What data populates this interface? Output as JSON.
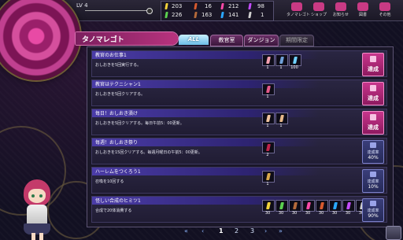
{
  "header": {
    "level_label": "LV 4",
    "resources": [
      {
        "value": "203",
        "color": "#f2d23a"
      },
      {
        "value": "16",
        "color": "#d85a2e"
      },
      {
        "value": "212",
        "color": "#ff4aa8"
      },
      {
        "value": "98",
        "color": "#c44cff"
      },
      {
        "value": "226",
        "color": "#5bd14f"
      },
      {
        "value": "163",
        "color": "#b46a3a"
      },
      {
        "value": "141",
        "color": "#2aa8ff"
      },
      {
        "value": "1",
        "color": "#cfcfcf"
      }
    ],
    "nav": [
      {
        "label": "タノマレゴト",
        "icon": "scroll-icon",
        "color": "#c93a84"
      },
      {
        "label": "ショップ",
        "icon": "shop-icon",
        "color": "#c93a84"
      },
      {
        "label": "お知らせ",
        "icon": "mail-icon",
        "color": "#c93a84"
      },
      {
        "label": "図書",
        "icon": "book-icon",
        "color": "#c93a84"
      },
      {
        "label": "その他",
        "icon": "menu-icon",
        "color": "#c93a84"
      }
    ]
  },
  "page": {
    "title": "タノマレゴト",
    "tabs": [
      "ALL",
      "教官室",
      "ダンジョン",
      "期間限定"
    ]
  },
  "quests": [
    {
      "title": "教官のお仕事1",
      "desc": "おしおきを5回実行する。",
      "status": "達成",
      "rewards": [
        {
          "color": "#f3a0b0",
          "qty": "1"
        },
        {
          "color": "#6fa0d8",
          "qty": "1"
        },
        {
          "color": "#6fd0ff",
          "qty": "100"
        }
      ]
    },
    {
      "title": "教官はテクニシャン1",
      "desc": "おしおきを5回クリアする。",
      "status": "達成",
      "rewards": [
        {
          "color": "#e45a8a",
          "qty": "1"
        }
      ]
    },
    {
      "title": "毎日！おしおき漬け",
      "desc": "おしおきを5回クリアする。毎日午前5：00更新。",
      "status": "達成",
      "rewards": [
        {
          "color": "#f1c4a0",
          "qty": "1"
        },
        {
          "color": "#e8b88a",
          "qty": "1"
        }
      ]
    },
    {
      "title": "毎週！おしおき祭り",
      "desc": "おしおきを15回クリアする。毎週月曜日の午前5：00更新。",
      "status": "達成率",
      "percent": "40%",
      "rewards": [
        {
          "color": "#c0244a",
          "qty": "2"
        }
      ]
    },
    {
      "title": "ハーレムをつくろう1",
      "desc": "召喚を10回する",
      "status": "達成率",
      "percent": "10%",
      "rewards": [
        {
          "color": "#d9a84a",
          "qty": "1"
        }
      ]
    },
    {
      "title": "怪しい合成のヒミツ1",
      "desc": "合成で20体消費する",
      "status": "達成率",
      "percent": "90%",
      "rewards": [
        {
          "color": "#f2d23a",
          "qty": "30"
        },
        {
          "color": "#5bd14f",
          "qty": "30"
        },
        {
          "color": "#b46a3a",
          "qty": "30"
        },
        {
          "color": "#ff4aa8",
          "qty": "30"
        },
        {
          "color": "#d85a2e",
          "qty": "30"
        },
        {
          "color": "#2aa8ff",
          "qty": "30"
        },
        {
          "color": "#c44cff",
          "qty": "30"
        },
        {
          "color": "#cfcfcf",
          "qty": "30"
        }
      ]
    }
  ],
  "pager": {
    "first": "«",
    "prev": "‹",
    "pages": [
      "1",
      "2",
      "3"
    ],
    "next": "›",
    "last": "»"
  }
}
